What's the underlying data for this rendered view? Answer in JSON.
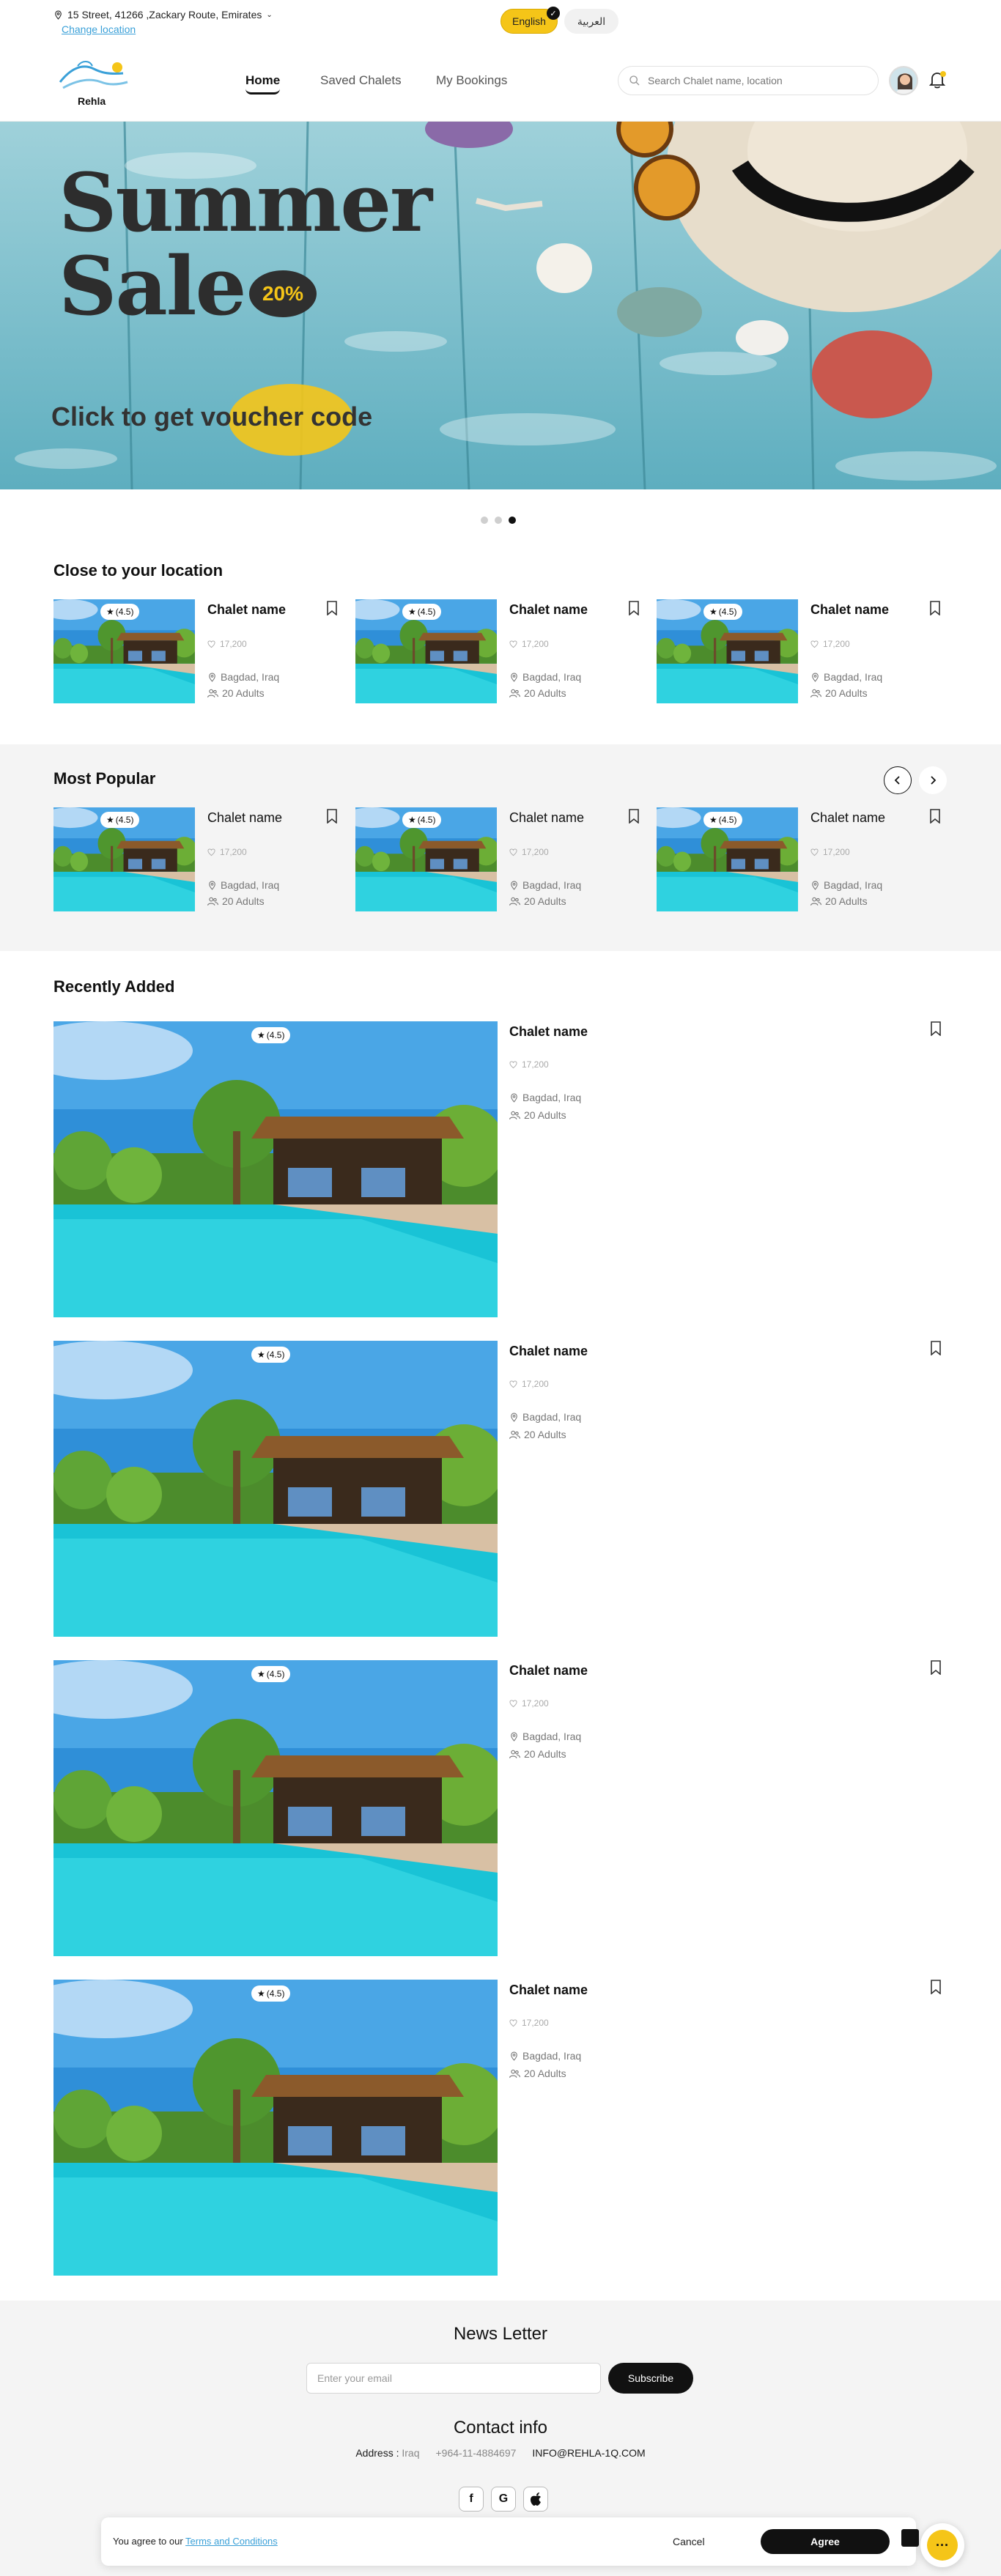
{
  "header": {
    "address": "15 Street, 41266 ,Zackary Route, Emirates",
    "change_location": "Change location",
    "lang_en": "English",
    "lang_ar": "العربية"
  },
  "nav": {
    "logo_text": "Rehla",
    "links": [
      "Home",
      "Saved Chalets",
      "My Bookings"
    ],
    "search_placeholder": "Search Chalet name, location"
  },
  "hero": {
    "line1": "Summer",
    "line2": "Sale",
    "discount": "20%",
    "cta": "Click to get voucher code",
    "active_slide": 3,
    "slides": 3
  },
  "sections": {
    "close": "Close to your location",
    "popular": "Most Popular",
    "recent": "Recently Added"
  },
  "chalet": {
    "name": "Chalet name",
    "rating": "(4.5)",
    "likes": "17,200",
    "city": "Bagdad, Iraq",
    "adults": "20 Adults"
  },
  "footer": {
    "newsletter_title": "News Letter",
    "email_placeholder": "Enter your email",
    "subscribe": "Subscribe",
    "contact_title": "Contact info",
    "address_label": "Address :",
    "address_value": "Iraq",
    "phone": "+964-11-4884697",
    "email": "INFO@REHLA-1Q.COM"
  },
  "consent": {
    "text": "You agree to our",
    "link": "Terms and Conditions",
    "cancel": "Cancel",
    "agree": "Agree"
  },
  "colors": {
    "accent": "#f5c518",
    "link": "#3aa0d8",
    "dark": "#111111"
  }
}
